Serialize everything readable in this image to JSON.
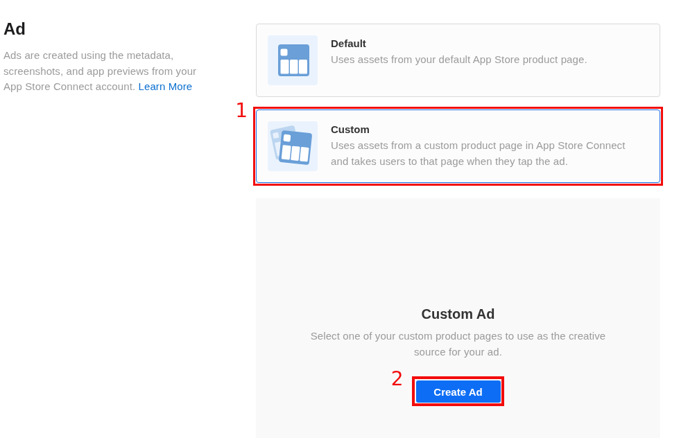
{
  "intro": {
    "title": "Ad",
    "description": "Ads are created using the metadata, screenshots, and app previews from your App Store Connect account.",
    "link": "Learn More"
  },
  "ad_types": [
    {
      "kind": "default",
      "title": "Default",
      "description": "Uses assets from your default App Store product page.",
      "selected": false
    },
    {
      "kind": "custom",
      "title": "Custom",
      "description": "Uses assets from a custom product page in App Store Connect and takes users to that page when they tap the ad.",
      "selected": true,
      "callout": "1"
    }
  ],
  "custom_ad_panel": {
    "title": "Custom Ad",
    "description": "Select one of your custom product pages to use as the creative source for your ad.",
    "button": {
      "label": "Create Ad",
      "callout": "2"
    }
  }
}
